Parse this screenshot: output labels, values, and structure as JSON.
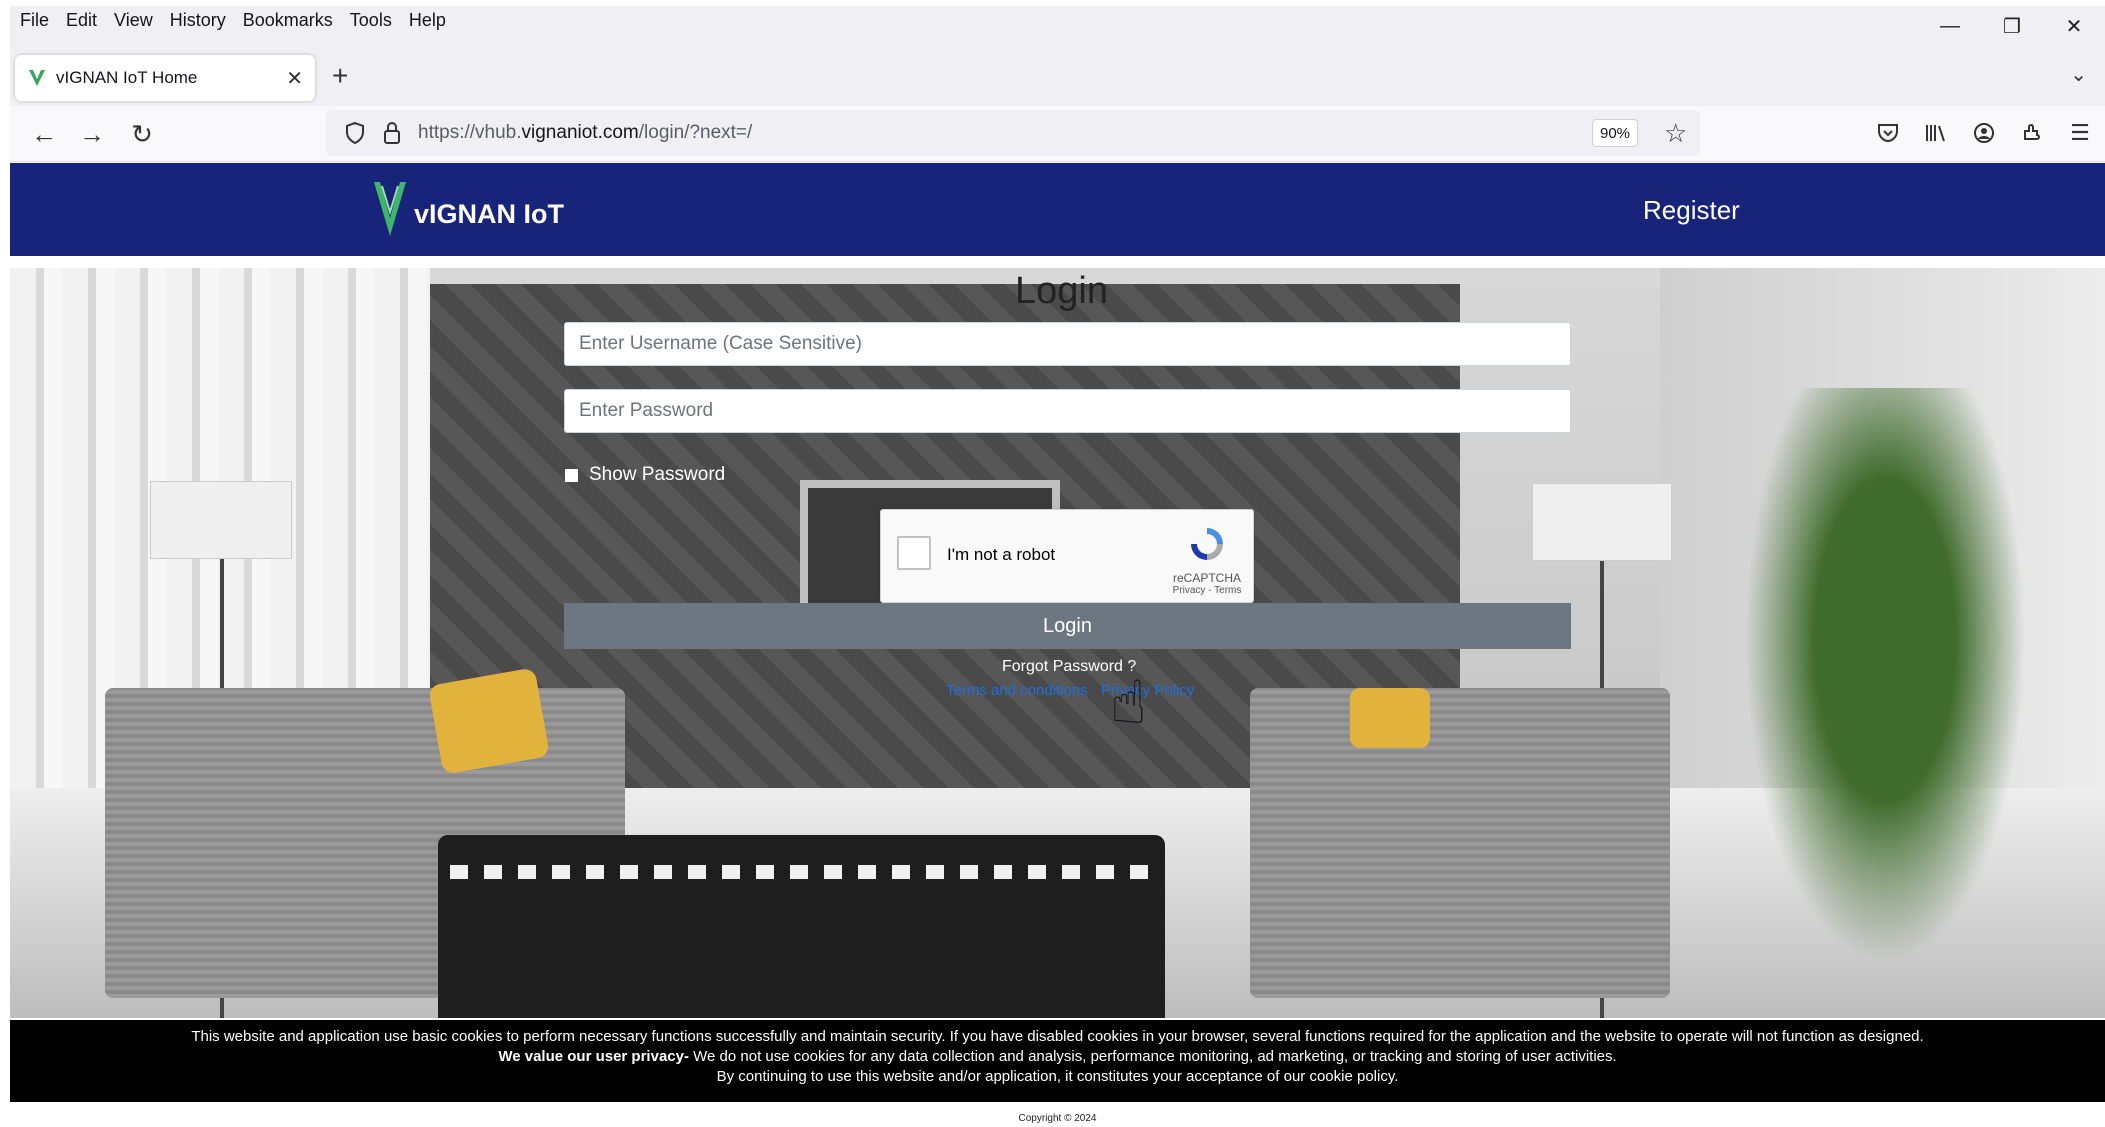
{
  "menubar": {
    "items": [
      "File",
      "Edit",
      "View",
      "History",
      "Bookmarks",
      "Tools",
      "Help"
    ]
  },
  "tab": {
    "title": "vIGNAN IoT Home"
  },
  "navbar": {
    "url_prefix": "https://vhub.",
    "url_domain": "vignaniot.com",
    "url_path": "/login/?next=/",
    "zoom": "90%"
  },
  "site": {
    "brand": "vIGNAN IoT",
    "register_label": "Register",
    "brand_color": "#18237a"
  },
  "login": {
    "title": "Login",
    "username_placeholder": "Enter Username (Case Sensitive)",
    "password_placeholder": "Enter Password",
    "show_password_label": "Show Password",
    "submit_label": "Login",
    "forgot_label": "Forgot Password ?",
    "terms_label": "Terms and conditions",
    "privacy_label": "Privacy Policy"
  },
  "recaptcha": {
    "label": "I'm not a robot",
    "brand": "reCAPTCHA",
    "links": "Privacy - Terms"
  },
  "cookie": {
    "line1": "This website and application use basic cookies to perform necessary functions successfully and maintain security. If you have disabled cookies in your browser, several functions required for the application and the website to operate will not function as designed.",
    "line2_bold": "We value our user privacy-",
    "line2_rest": " We do not use cookies for any data collection and analysis, performance monitoring, ad marketing, or tracking and storing of user activities.",
    "line3": "By continuing to use this website and/or application, it constitutes your acceptance of our cookie policy."
  },
  "footer": {
    "copyright": "Copyright © 2024"
  }
}
